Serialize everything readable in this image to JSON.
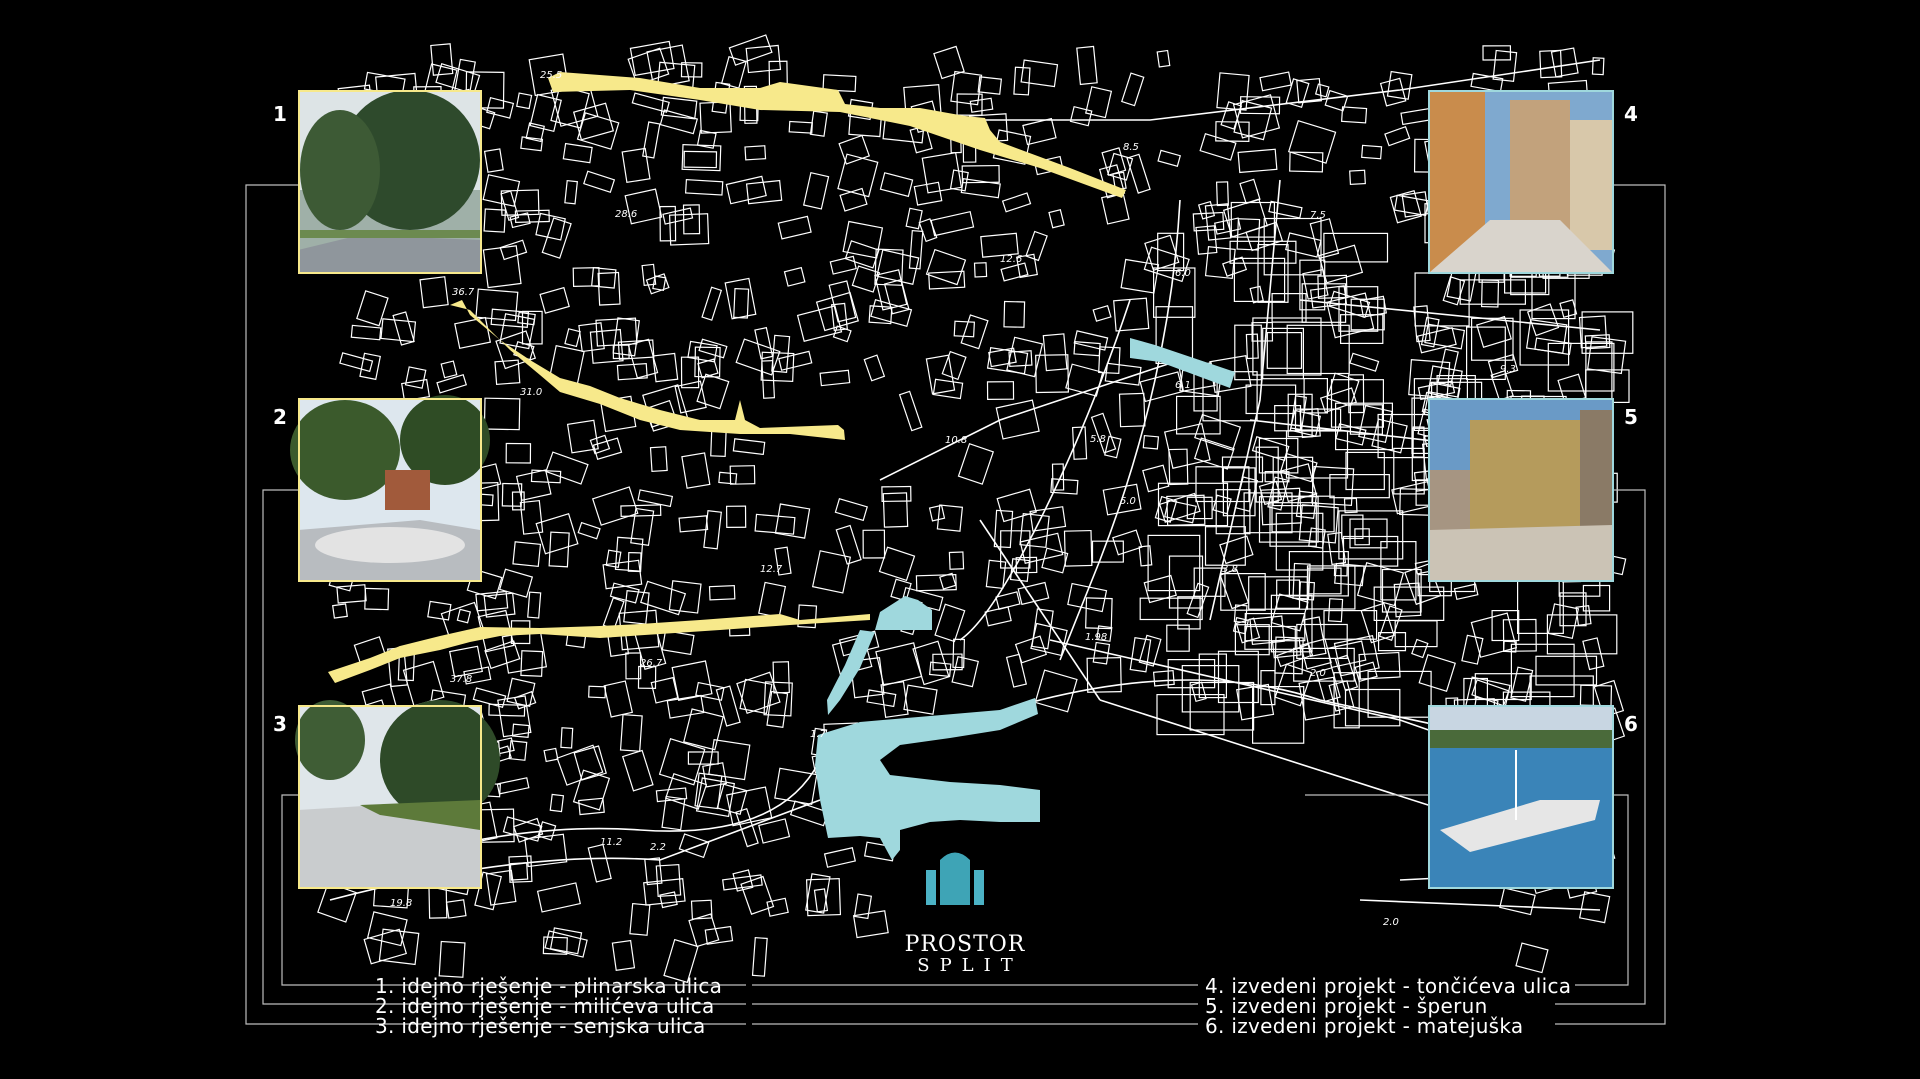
{
  "panels": [
    {
      "number": "1",
      "title": "idejno rješenje - plinarska ulica",
      "type": "yellow"
    },
    {
      "number": "2",
      "title": "idejno rješenje - milićeva ulica",
      "type": "yellow"
    },
    {
      "number": "3",
      "title": "idejno rješenje - senjska ulica",
      "type": "yellow"
    },
    {
      "number": "4",
      "title": "izvedeni projekt - tončićeva ulica",
      "type": "cyan"
    },
    {
      "number": "5",
      "title": "izvedeni projekt - šperun",
      "type": "cyan"
    },
    {
      "number": "6",
      "title": "izvedeni projekt - matejuška",
      "type": "cyan"
    }
  ],
  "legend": [
    "1. idejno rješenje - plinarska ulica",
    "2. idejno rješenje - milićeva ulica",
    "3. idejno rješenje - senjska ulica",
    "4. izvedeni projekt - tončićeva ulica",
    "5. izvedeni projekt - šperun",
    "6. izvedeni projekt - matejuška"
  ],
  "elevation_labels": [
    "25.5",
    "8.5",
    "7.5",
    "6.0",
    "9.3",
    "6.1",
    "5.8",
    "5.0",
    "10.8",
    "28.6",
    "12.6",
    "36.7",
    "31.0",
    "12.7",
    "3.8",
    "1.98",
    "2.0",
    "26.7",
    "37.8",
    "1.7",
    "11.2",
    "2.2",
    "19.8",
    "2.0"
  ],
  "logo": {
    "name": "PROSTOR",
    "sub": "SPLIT"
  },
  "colors": {
    "background": "#000000",
    "map_lines": "#ffffff",
    "proposed": "#f7e98b",
    "built": "#9fd8dd"
  }
}
